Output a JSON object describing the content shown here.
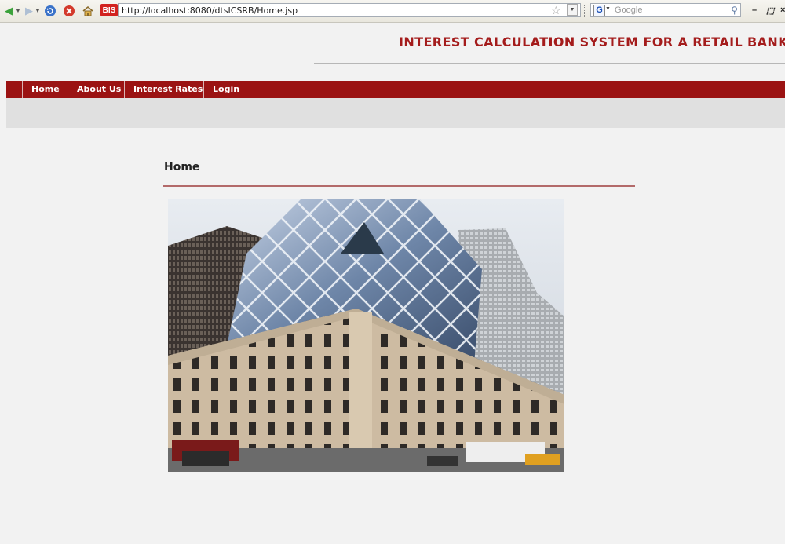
{
  "browser": {
    "url": "http://localhost:8080/dtsICSRB/Home.jsp",
    "favicon_text": "BIS",
    "search_placeholder": "Google",
    "icons": [
      "back-arrow-icon",
      "forward-arrow-icon",
      "reload-icon",
      "stop-icon",
      "home-icon",
      "bookmark-star-icon",
      "search-magnifier-icon"
    ]
  },
  "header": {
    "site_title": "INTEREST CALCULATION SYSTEM FOR A RETAIL BANK"
  },
  "nav": {
    "items": [
      {
        "label": "Home"
      },
      {
        "label": "About Us"
      },
      {
        "label": "Interest Rates"
      },
      {
        "label": "Login"
      }
    ]
  },
  "content": {
    "heading": "Home"
  },
  "colors": {
    "brand_red": "#9b1313",
    "title_red": "#a41c1c",
    "page_bg": "#f2f2f2"
  }
}
